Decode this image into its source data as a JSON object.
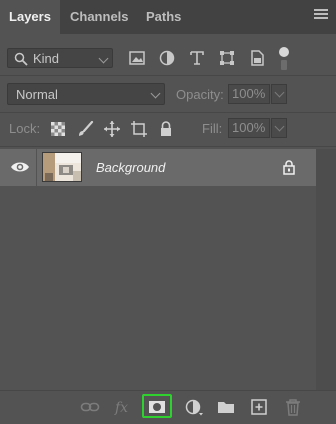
{
  "tabs": [
    {
      "label": "Layers",
      "active": true
    },
    {
      "label": "Channels",
      "active": false
    },
    {
      "label": "Paths",
      "active": false
    }
  ],
  "filter": {
    "kind_label": "Kind",
    "icons": [
      "image-filter-icon",
      "adjustment-filter-icon",
      "type-filter-icon",
      "shape-filter-icon",
      "smart-object-filter-icon"
    ]
  },
  "blend": {
    "mode": "Normal",
    "opacity_label": "Opacity:",
    "opacity_value": "100%"
  },
  "lock": {
    "label": "Lock:",
    "fill_label": "Fill:",
    "fill_value": "100%",
    "icons": [
      "lock-transparent-pixels-icon",
      "lock-image-pixels-icon",
      "lock-position-icon",
      "lock-artboard-icon",
      "lock-all-icon"
    ]
  },
  "layers": [
    {
      "name": "Background",
      "visible": true,
      "locked": true
    }
  ],
  "bottom_icons": [
    "link-layers-icon",
    "fx-icon",
    "add-mask-icon",
    "adjustment-layer-icon",
    "new-group-icon",
    "new-layer-icon",
    "delete-layer-icon"
  ],
  "colors": {
    "highlight": "#2fd12f",
    "panel": "#535353",
    "selected_row": "#6a6a6a"
  }
}
